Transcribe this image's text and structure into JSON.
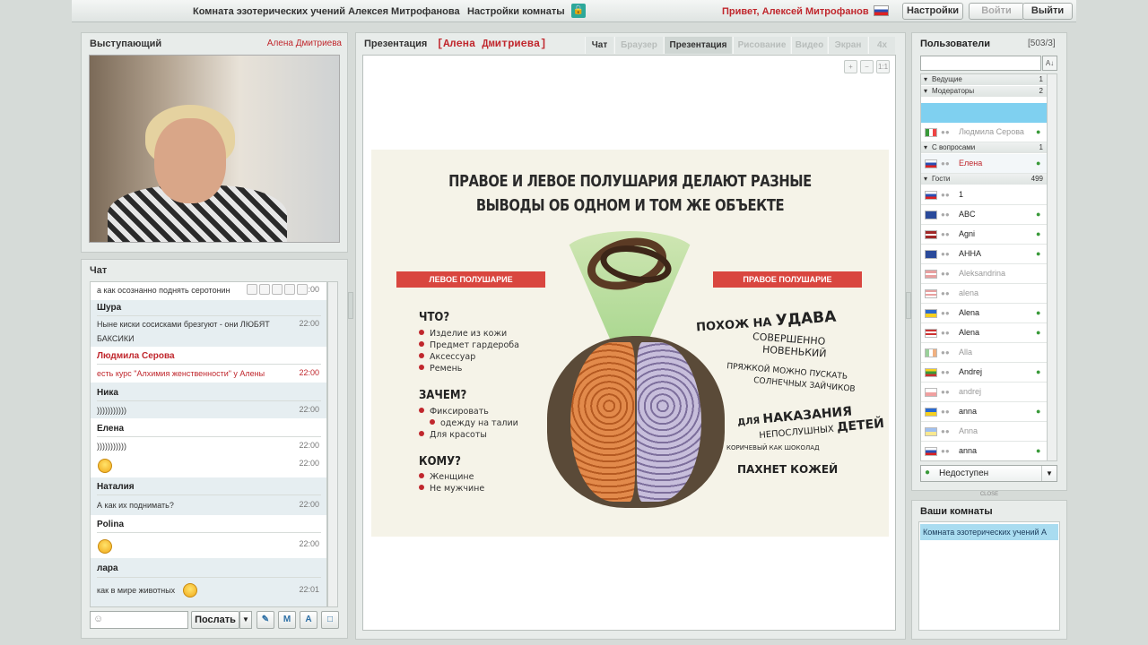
{
  "topbar": {
    "room_title": "Комната эзотерических учений Алексея Митрофанова",
    "room_settings": "Настройки комнаты",
    "greeting": "Привет, Алексей Митрофанов",
    "settings_btn": "Настройки",
    "login_btn": "Войти",
    "logout_btn": "Выйти"
  },
  "speaker": {
    "title": "Выступающий",
    "name": "Алена Дмитриева"
  },
  "chat": {
    "title": "Чат",
    "send_label": "Послать",
    "messages": [
      {
        "author": "",
        "text": "а как осознанно поднять серотонин",
        "time": "22:00"
      },
      {
        "author": "Шура",
        "text": "Ныне киски сосисками брезгуют - они ЛЮБЯТ",
        "text2": "БАКСИКИ",
        "time": "22:00"
      },
      {
        "author": "Людмила Серова",
        "text": "есть курс \"Алхимия женственности\" у Алены",
        "time": "22:00"
      },
      {
        "author": "Ника",
        "text": ")))))))))))",
        "time": "22:00"
      },
      {
        "author": "Елена",
        "text": ")))))))))))",
        "time": "22:00",
        "time2": "22:00"
      },
      {
        "author": "Наталия",
        "text": "А как их поднимать?",
        "time": "22:00"
      },
      {
        "author": "Polina",
        "text": "",
        "time": "22:00"
      },
      {
        "author": "лара",
        "text": "как в мире животных",
        "time": "22:01"
      }
    ]
  },
  "presentation": {
    "title": "Презентация",
    "speaker": "[Алена Дмитриева]",
    "tabs": [
      "Чат",
      "Браузер",
      "Презентация",
      "Рисование",
      "Видео",
      "Экран",
      "4x"
    ],
    "slide": {
      "headline1": "ПРАВОЕ И ЛЕВОЕ ПОЛУШАРИЯ ДЕЛАЮТ РАЗНЫЕ",
      "headline2": "ВЫВОДЫ ОБ ОДНОМ И ТОМ ЖЕ ОБЪЕКТЕ",
      "left_label": "ЛЕВОЕ ПОЛУШАРИЕ",
      "right_label": "ПРАВОЕ ПОЛУШАРИЕ",
      "q1": "ЧТО?",
      "q1_items": [
        "Изделие из кожи",
        "Предмет гардероба",
        "Аксессуар",
        "Ремень"
      ],
      "q2": "ЗАЧЕМ?",
      "q2_items": [
        "Фиксировать",
        "одежду на талии",
        "Для красоты"
      ],
      "q3": "КОМУ?",
      "q3_items": [
        "Женщине",
        "Не мужчине"
      ],
      "r1a": "ПОХОЖ НА",
      "r1b": "УДАВА",
      "r2a": "СОВЕРШЕННО",
      "r2b": "НОВЕНЬКИЙ",
      "r3a": "ПРЯЖКОЙ МОЖНО ПУСКАТЬ",
      "r3b": "СОЛНЕЧНЫХ ЗАЙЧИКОВ",
      "r4a": "ДЛЯ",
      "r4b": "НАКАЗАНИЯ",
      "r4c": "НЕПОСЛУШНЫХ",
      "r4d": "ДЕТЕЙ",
      "r5": "КОРИЧЕВЫЙ КАК ШОКОЛАД",
      "r6": "ПАХНЕТ КОЖЕЙ"
    }
  },
  "users": {
    "title": "Пользователи",
    "count": "[503/3]",
    "groups": {
      "leads": {
        "label": "Ведущие",
        "count": "1"
      },
      "mods": {
        "label": "Модераторы",
        "count": "2"
      },
      "questions": {
        "label": "С вопросами",
        "count": "1"
      },
      "guests": {
        "label": "Гости",
        "count": "499"
      }
    },
    "moderator_row": "Людмила Серова",
    "question_row": "Елена",
    "guests": [
      {
        "name": "1",
        "grey": false
      },
      {
        "name": "ABC",
        "grey": false
      },
      {
        "name": "Agni",
        "grey": false
      },
      {
        "name": "AHHA",
        "grey": false
      },
      {
        "name": "Aleksandrina",
        "grey": true
      },
      {
        "name": "alena",
        "grey": true
      },
      {
        "name": "Alena",
        "grey": false
      },
      {
        "name": "Alena",
        "grey": false
      },
      {
        "name": "Alla",
        "grey": true
      },
      {
        "name": "Andrej",
        "grey": false
      },
      {
        "name": "andrej",
        "grey": true
      },
      {
        "name": "anna",
        "grey": false
      },
      {
        "name": "Anna",
        "grey": true
      },
      {
        "name": "anna",
        "grey": false
      }
    ],
    "status": "Недоступен",
    "close_label": "CLOSE"
  },
  "rooms": {
    "title": "Ваши комнаты",
    "item": "Комната эзотерических учений А"
  }
}
